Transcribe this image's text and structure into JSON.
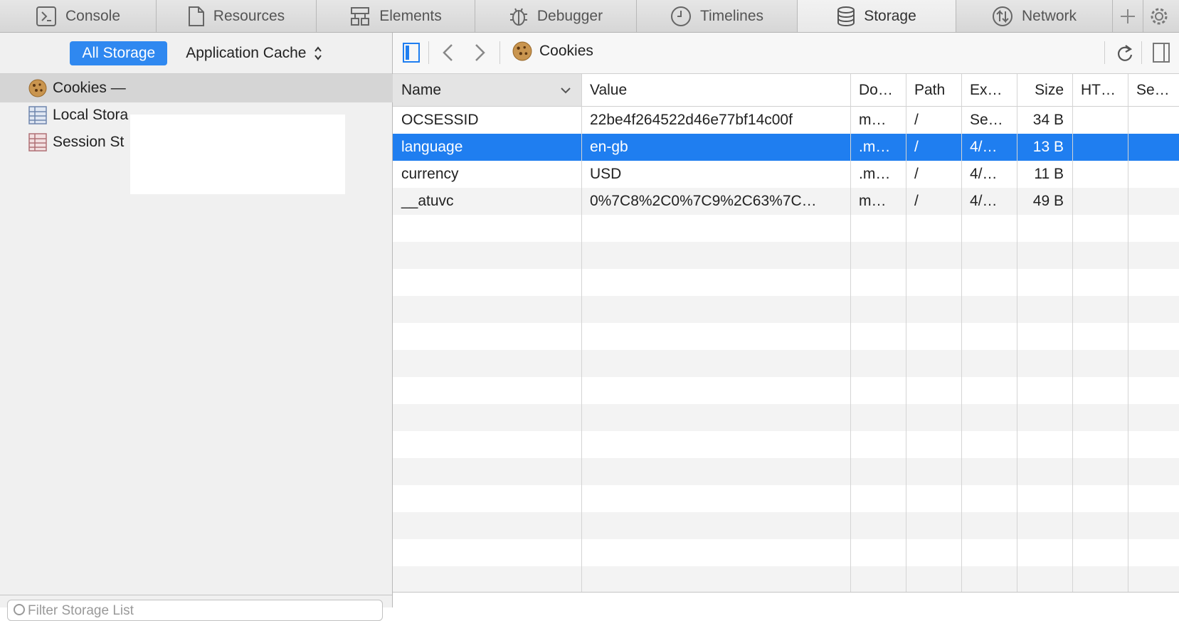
{
  "tabs": [
    {
      "id": "console",
      "label": "Console",
      "icon": "console-icon"
    },
    {
      "id": "resources",
      "label": "Resources",
      "icon": "document-icon"
    },
    {
      "id": "elements",
      "label": "Elements",
      "icon": "elements-icon"
    },
    {
      "id": "debugger",
      "label": "Debugger",
      "icon": "bug-icon"
    },
    {
      "id": "timelines",
      "label": "Timelines",
      "icon": "clock-icon"
    },
    {
      "id": "storage",
      "label": "Storage",
      "icon": "database-icon",
      "active": true
    },
    {
      "id": "network",
      "label": "Network",
      "icon": "network-icon"
    }
  ],
  "sidebar": {
    "scope_all": "All Storage",
    "scope_cache": "Application Cache",
    "items": [
      {
        "label": "Cookies —",
        "icon": "cookie-icon",
        "selected": true
      },
      {
        "label": "Local Stora",
        "icon": "table-icon-blue"
      },
      {
        "label": "Session St",
        "icon": "table-icon-red"
      }
    ],
    "filter_placeholder": "Filter Storage List"
  },
  "navbar": {
    "breadcrumb": "Cookies"
  },
  "grid": {
    "columns": [
      "Name",
      "Value",
      "Do…",
      "Path",
      "Ex…",
      "Size",
      "HT…",
      "Se…"
    ],
    "rows": [
      {
        "name": "OCSESSID",
        "value": "22be4f264522d46e77bf14c00f",
        "domain": "m…",
        "path": "/",
        "expires": "Se…",
        "size": "34 B",
        "http": "",
        "secure": ""
      },
      {
        "name": "language",
        "value": "en-gb",
        "domain": ".m…",
        "path": "/",
        "expires": "4/…",
        "size": "13 B",
        "http": "",
        "secure": "",
        "selected": true
      },
      {
        "name": "currency",
        "value": "USD",
        "domain": ".m…",
        "path": "/",
        "expires": "4/…",
        "size": "11 B",
        "http": "",
        "secure": ""
      },
      {
        "name": "__atuvc",
        "value": "0%7C8%2C0%7C9%2C63%7C…",
        "domain": "m…",
        "path": "/",
        "expires": "4/…",
        "size": "49 B",
        "http": "",
        "secure": ""
      }
    ]
  },
  "colors": {
    "accent": "#1f7ef0",
    "scope_button": "#2f88f0"
  }
}
